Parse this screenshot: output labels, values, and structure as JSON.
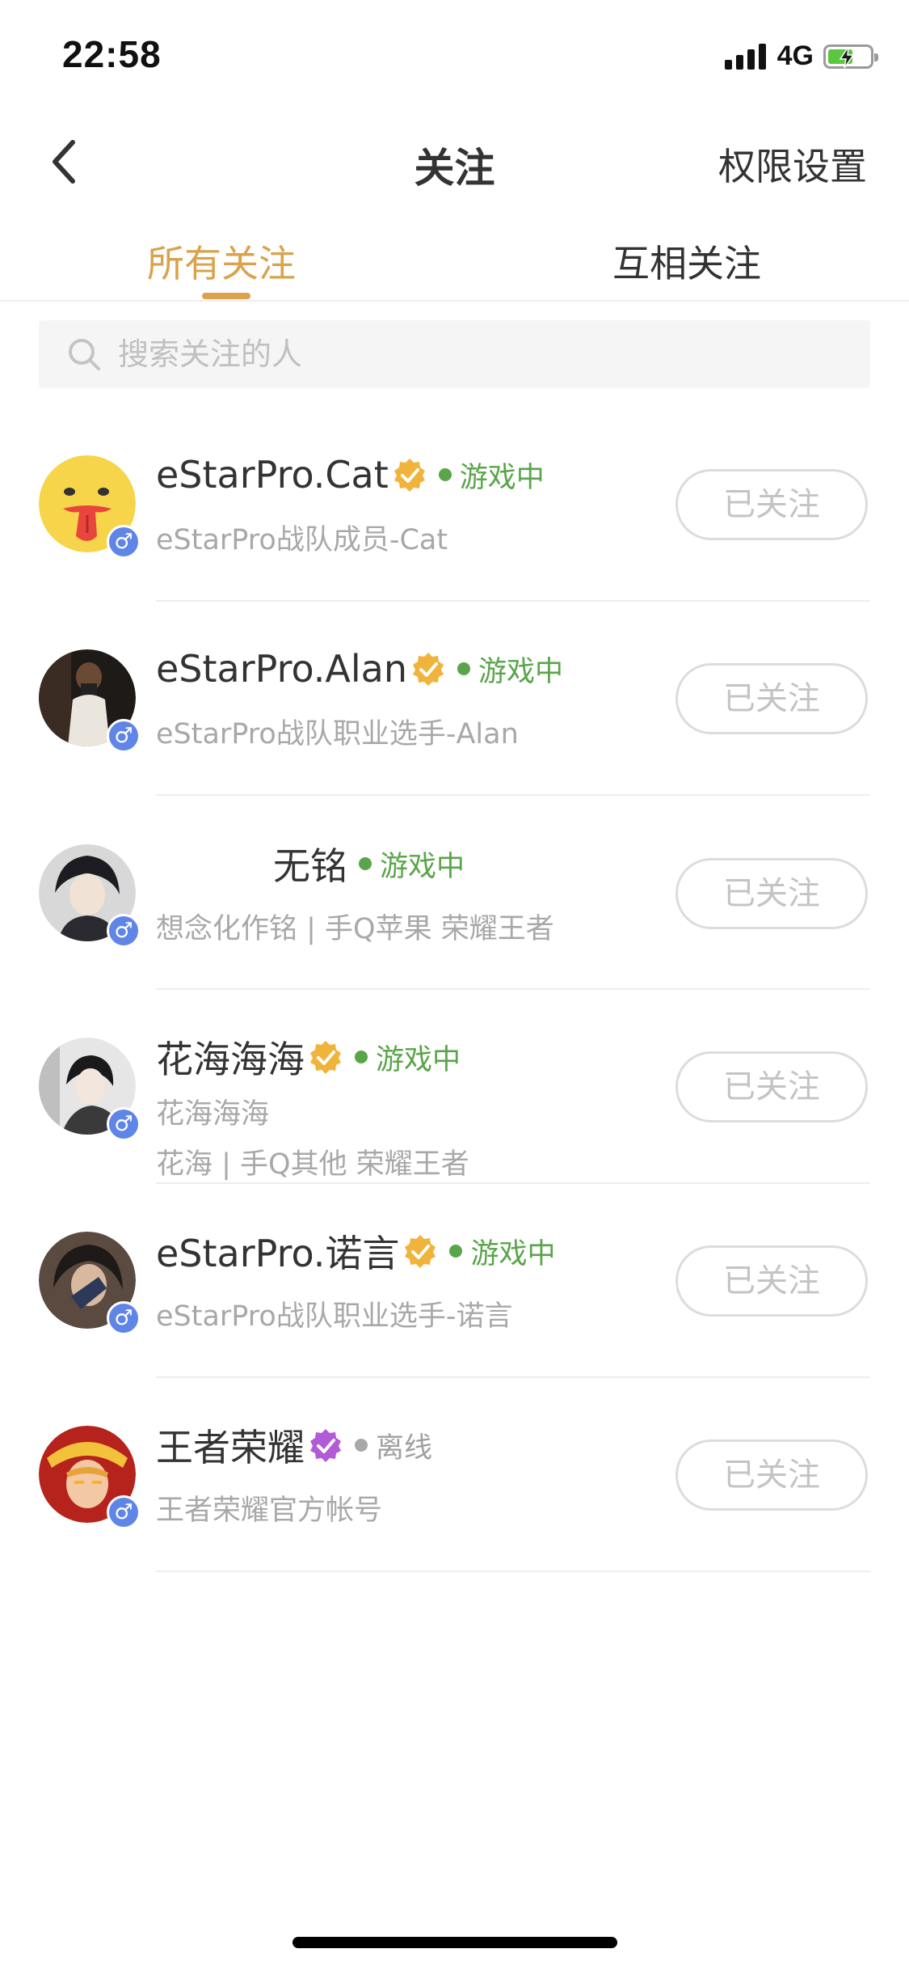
{
  "status_bar": {
    "time": "22:58",
    "network": "4G",
    "battery_percent": 60
  },
  "header": {
    "title": "关注",
    "back_icon": "chevron-left-icon",
    "permission_label": "权限设置"
  },
  "tabs": [
    {
      "label": "所有关注",
      "active": true
    },
    {
      "label": "互相关注",
      "active": false
    }
  ],
  "search": {
    "placeholder": "搜索关注的人",
    "icon": "search-icon"
  },
  "colors": {
    "accent": "#d9a24b",
    "online": "#5aa54a",
    "offline": "#a8a8a8",
    "verify_gold": "#f0b43c",
    "verify_purple": "#b25bd6",
    "male_badge": "#5f86e6"
  },
  "follows": [
    {
      "name": "eStarPro.Cat",
      "verified": "gold",
      "status": "游戏中",
      "online": true,
      "lines": [
        "eStarPro战队成员-Cat"
      ],
      "gender": "♂",
      "button": "已关注"
    },
    {
      "name": "eStarPro.Alan",
      "verified": "gold",
      "status": "游戏中",
      "online": true,
      "lines": [
        "eStarPro战队职业选手-Alan"
      ],
      "gender": "♂",
      "button": "已关注"
    },
    {
      "name": "无铭",
      "verified": "none",
      "status": "游戏中",
      "online": true,
      "lines": [
        "想念化作铭 | 手Q苹果 荣耀王者"
      ],
      "gender": "♂",
      "button": "已关注"
    },
    {
      "name": "花海海海",
      "verified": "gold",
      "status": "游戏中",
      "online": true,
      "lines": [
        "花海海海",
        "花海 | 手Q其他 荣耀王者"
      ],
      "gender": "♂",
      "button": "已关注"
    },
    {
      "name": "eStarPro.诺言",
      "verified": "gold",
      "status": "游戏中",
      "online": true,
      "lines": [
        "eStarPro战队职业选手-诺言"
      ],
      "gender": "♂",
      "button": "已关注"
    },
    {
      "name": "王者荣耀",
      "verified": "purple",
      "status": "离线",
      "online": false,
      "lines": [
        "王者荣耀官方帐号"
      ],
      "gender": "♂",
      "button": "已关注"
    }
  ]
}
